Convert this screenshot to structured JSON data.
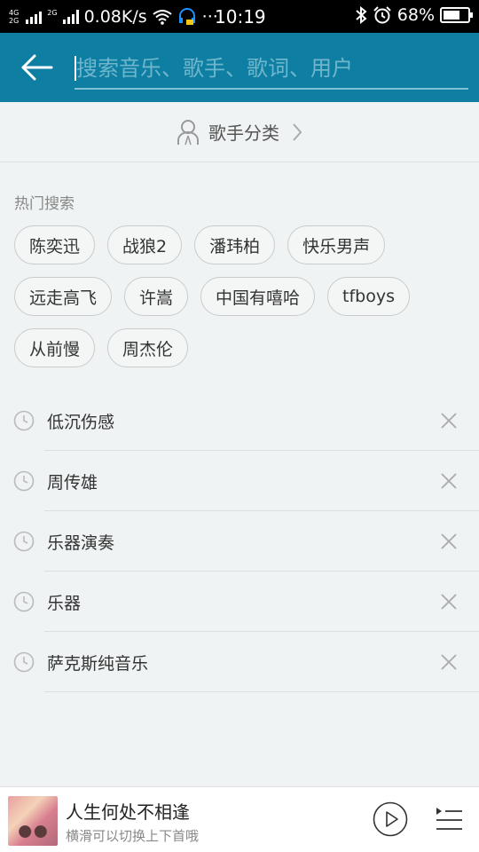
{
  "status_bar": {
    "net_top": "4G",
    "net_bottom": "2G",
    "net_badge": "2G",
    "speed": "0.08K/s",
    "more": "···",
    "time": "10:19",
    "battery": "68%",
    "battery_level": 0.68
  },
  "search": {
    "placeholder": "搜索音乐、歌手、歌词、用户",
    "value": ""
  },
  "singer_category": {
    "label": "歌手分类"
  },
  "hot_search": {
    "title": "热门搜索",
    "tags": [
      "陈奕迅",
      "战狼2",
      "潘玮柏",
      "快乐男声",
      "远走高飞",
      "许嵩",
      "中国有嘻哈",
      "tfboys",
      "从前慢",
      "周杰伦"
    ]
  },
  "history": {
    "items": [
      "低沉伤感",
      "周传雄",
      "乐器演奏",
      "乐器",
      "萨克斯纯音乐"
    ]
  },
  "player": {
    "title": "人生何处不相逢",
    "subtitle": "横滑可以切换上下首哦"
  },
  "colors": {
    "header": "#0e7fa2",
    "background": "#eff3f3"
  },
  "icons": {
    "back": "arrow-left-icon",
    "singer": "person-icon",
    "chevron": "chevron-right-icon",
    "history": "clock-icon",
    "delete": "close-icon",
    "play": "play-icon",
    "playlist": "playlist-icon"
  }
}
